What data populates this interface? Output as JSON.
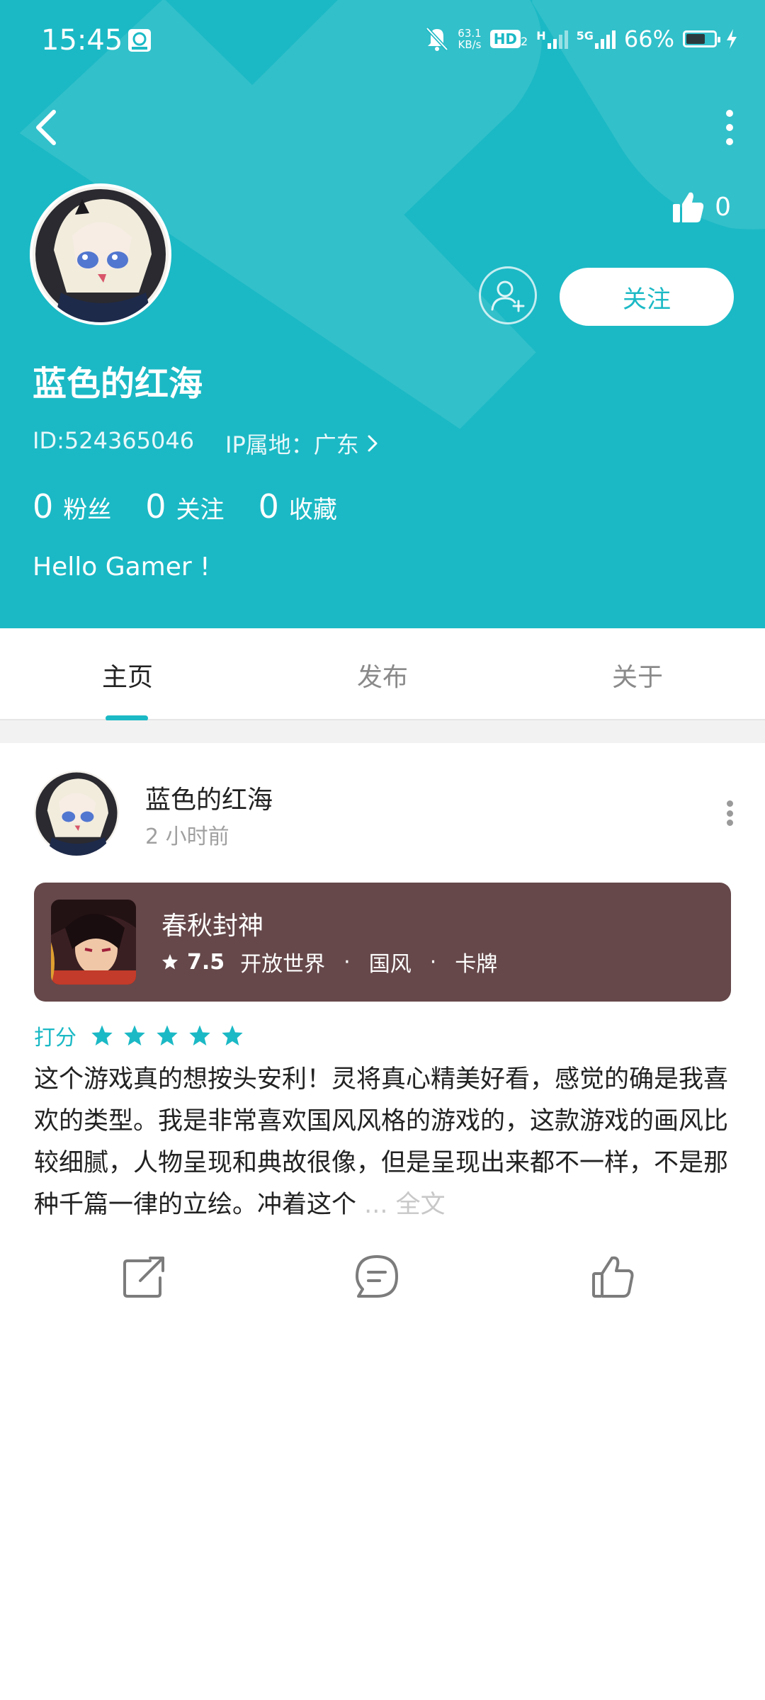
{
  "status_bar": {
    "time": "15:45",
    "net_speed_value": "63.1",
    "net_speed_unit": "KB/s",
    "hd_label": "HD",
    "hd_sub": "2",
    "h_label": "H",
    "fiveg_label": "5G",
    "battery_pct": "66%"
  },
  "profile": {
    "like_count": "0",
    "follow_button": "关注",
    "username": "蓝色的红海",
    "user_id": "ID:524365046",
    "ip_location": "IP属地：广东",
    "stats": [
      {
        "num": "0",
        "label": "粉丝"
      },
      {
        "num": "0",
        "label": "关注"
      },
      {
        "num": "0",
        "label": "收藏"
      }
    ],
    "bio": "Hello Gamer !"
  },
  "tabs": [
    "主页",
    "发布",
    "关于"
  ],
  "post": {
    "author": "蓝色的红海",
    "time": "2 小时前",
    "game": {
      "name": "春秋封神",
      "score": "7.5",
      "tags": [
        "开放世界",
        "国风",
        "卡牌"
      ],
      "tag_sep": "·"
    },
    "rating_label": "打分",
    "rating_stars": 5,
    "body": "这个游戏真的想按头安利！灵将真心精美好看，感觉的确是我喜欢的类型。我是非常喜欢国风风格的游戏的，这款游戏的画风比较细腻，人物呈现和典故很像，但是呈现出来都不一样，不是那种千篇一律的立绘。冲着这个",
    "more_link": " ... 全文"
  },
  "colors": {
    "accent": "#1bb9c5",
    "game_card_bg": "#66484a"
  }
}
